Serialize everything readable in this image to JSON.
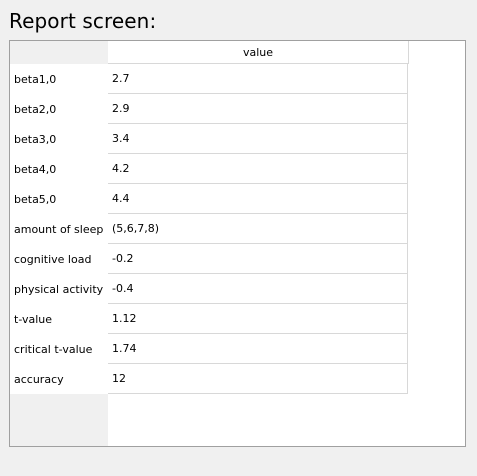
{
  "screen": {
    "title": "Report screen:"
  },
  "table": {
    "column_header": "value",
    "rows": [
      {
        "label": "beta1,0",
        "value": "2.7"
      },
      {
        "label": "beta2,0",
        "value": "2.9"
      },
      {
        "label": "beta3,0",
        "value": "3.4"
      },
      {
        "label": "beta4,0",
        "value": "4.2"
      },
      {
        "label": "beta5,0",
        "value": "4.4"
      },
      {
        "label": "amount of sleep",
        "value": "(5,6,7,8)"
      },
      {
        "label": "cognitive load",
        "value": "-0.2"
      },
      {
        "label": "physical activity",
        "value": "-0.4"
      },
      {
        "label": "t-value",
        "value": "1.12"
      },
      {
        "label": "critical  t-value",
        "value": "1.74"
      },
      {
        "label": "accuracy",
        "value": "12"
      }
    ]
  }
}
